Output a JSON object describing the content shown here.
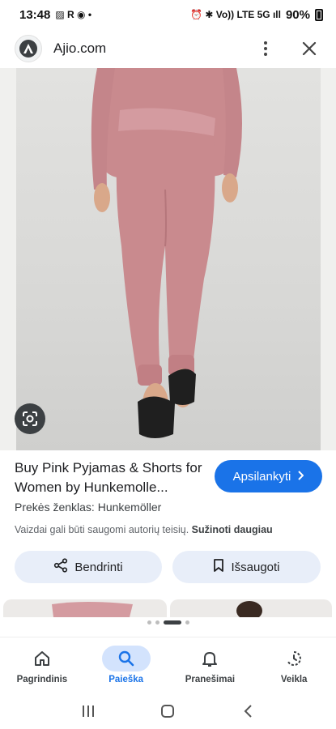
{
  "status_bar": {
    "time": "13:48",
    "left_glyphs": "▨ R ◉ •",
    "right_glyphs": "⏰ ✱ Vo)) LTE 5G ıll",
    "battery": "90%"
  },
  "url_bar": {
    "site": "Ajio.com"
  },
  "result": {
    "title": "Buy Pink Pyjamas & Shorts for Women by Hunkemolle...",
    "visit_label": "Apsilankyti",
    "brand": "Prekės ženklas: Hunkemöller",
    "rights_text": "Vaizdai gali būti saugomi autorių teisių.",
    "learn_more": "Sužinoti daugiau"
  },
  "actions": {
    "share_label": "Bendrinti",
    "save_label": "Išsaugoti"
  },
  "bottom_nav": {
    "items": [
      {
        "label": "Pagrindinis",
        "icon": "home-icon"
      },
      {
        "label": "Paieška",
        "icon": "search-icon",
        "active": true
      },
      {
        "label": "Pranešimai",
        "icon": "bell-icon"
      },
      {
        "label": "Veikla",
        "icon": "activity-icon"
      }
    ]
  },
  "colors": {
    "accent": "#1a73e8",
    "chip_bg": "#e8eef9",
    "active_nav_bg": "#d3e3fd",
    "garment": "#c98a8e"
  }
}
